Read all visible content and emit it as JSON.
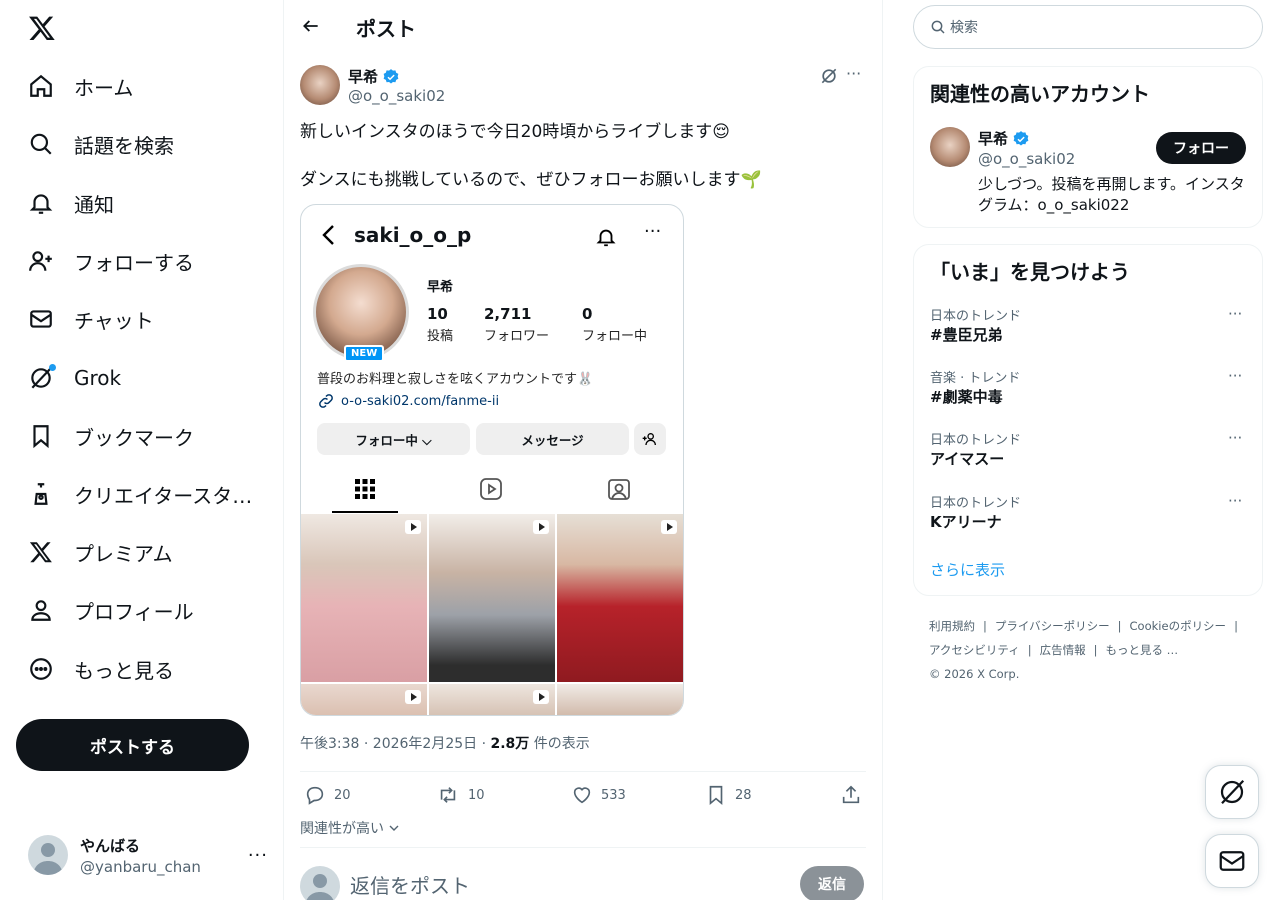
{
  "nav": {
    "items": [
      {
        "label": "ホーム"
      },
      {
        "label": "話題を検索"
      },
      {
        "label": "通知"
      },
      {
        "label": "フォローする"
      },
      {
        "label": "チャット"
      },
      {
        "label": "Grok"
      },
      {
        "label": "ブックマーク"
      },
      {
        "label": "クリエイタースタ…"
      },
      {
        "label": "プレミアム"
      },
      {
        "label": "プロフィール"
      },
      {
        "label": "もっと見る"
      }
    ],
    "post_button": "ポストする",
    "account": {
      "name": "やんばる",
      "handle": "@yanbaru_chan",
      "more": "···"
    }
  },
  "header": {
    "title": "ポスト"
  },
  "post": {
    "author_name": "早希",
    "author_handle": "@o_o_saki02",
    "text_line1": "新しいインスタのほうで今日20時頃からライブします😌",
    "text_line2": "ダンスにも挑戦しているので、ぜひフォローお願いします🌱",
    "time": "午後3:38 · 2026年2月25日 · ",
    "views_count": "2.8万",
    "views_label": " 件の表示",
    "replies": "20",
    "reposts": "10",
    "likes": "533",
    "bookmarks": "28",
    "more": "···",
    "relevance": "関連性が高い",
    "reply_placeholder": "返信をポスト",
    "reply_button": "返信"
  },
  "media": {
    "username": "saki_o_o_p",
    "display_name": "早希",
    "new_badge": "NEW",
    "more": "···",
    "stats": [
      {
        "n": "10",
        "l": "投稿"
      },
      {
        "n": "2,711",
        "l": "フォロワー"
      },
      {
        "n": "0",
        "l": "フォロー中"
      }
    ],
    "bio": "普段のお料理と寂しさを呟くアカウントです🐰",
    "link": "o-o-saki02.com/fanme-ii",
    "follow_btn": "フォロー中 ⌵",
    "message_btn": "メッセージ"
  },
  "right": {
    "search_placeholder": "検索",
    "recommend_title": "関連性の高いアカウント",
    "rec": {
      "name": "早希",
      "handle": "@o_o_saki02",
      "bio": "少しづつ。投稿を再開します。インスタグラム：o_o_saki022",
      "follow": "フォロー"
    },
    "trends_title": "「いま」を見つけよう",
    "trends": [
      {
        "cat": "日本のトレンド",
        "name": "#豊臣兄弟"
      },
      {
        "cat": "音楽 · トレンド",
        "name": "#劇薬中毒"
      },
      {
        "cat": "日本のトレンド",
        "name": "アイマスー"
      },
      {
        "cat": "日本のトレンド",
        "name": "Kアリーナ"
      }
    ],
    "trend_more": "···",
    "show_more": "さらに表示",
    "footer": {
      "terms": "利用規約",
      "privacy": "プライバシーポリシー",
      "cookie": "Cookieのポリシー",
      "access": "アクセシビリティ",
      "ads": "広告情報",
      "more": "もっと見る …",
      "copy": "© 2026 X Corp.",
      "sep": "|"
    }
  },
  "colors": {
    "accent": "#1d9bf0",
    "text": "#0f1419",
    "muted": "#536471",
    "button_dark": "#0f1419"
  }
}
